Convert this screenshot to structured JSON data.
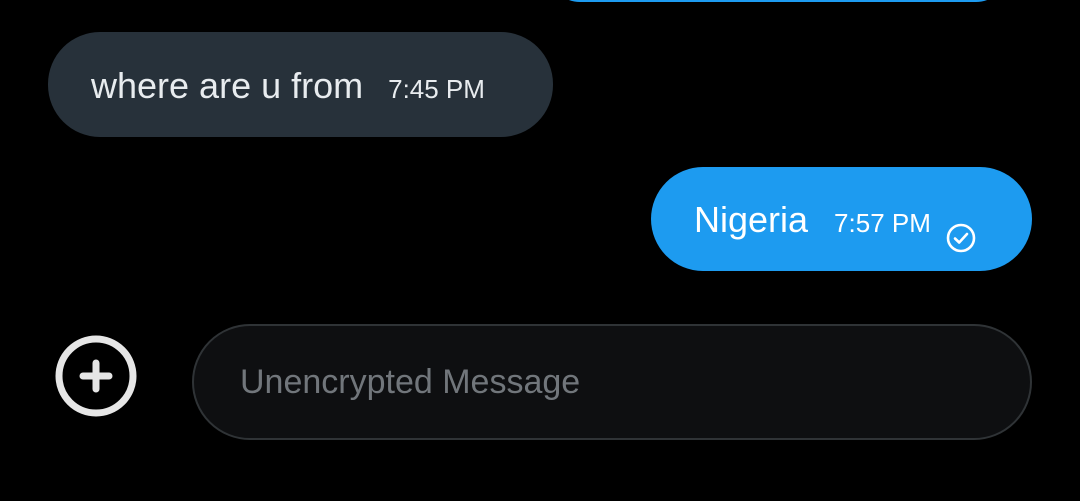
{
  "messages": [
    {
      "direction": "incoming",
      "text": "where are u from",
      "time": "7:45 PM"
    },
    {
      "direction": "outgoing",
      "text": "Nigeria",
      "time": "7:57 PM",
      "status_icon": "check-circle-icon"
    }
  ],
  "composer": {
    "placeholder": "Unencrypted Message",
    "value": "",
    "add_icon": "plus-circle-icon"
  },
  "colors": {
    "background": "#000000",
    "incoming_bubble": "#27313a",
    "outgoing_bubble": "#1d9bf0",
    "placeholder": "#71767b"
  }
}
